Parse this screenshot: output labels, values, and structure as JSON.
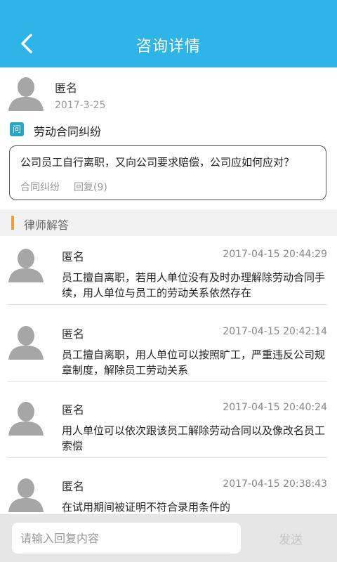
{
  "header": {
    "title": "咨询详情",
    "back_icon": "chevron-left-icon"
  },
  "question": {
    "asker_name": "匿名",
    "date": "2017-3-25",
    "badge": "问",
    "title": "劳动合同纠纷",
    "content": "公司员工自行离职，又向公司要求赔偿，公司应如何应对？",
    "tag": "合同纠纷",
    "reply_count": "回复(9)"
  },
  "section": {
    "title": "律师解答",
    "accent_color": "#f39c34"
  },
  "answers": [
    {
      "name": "匿名",
      "time": "2017-04-15 20:44:29",
      "text": "员工擅自离职，若用人单位没有及时办理解除劳动合同手续，用人单位与员工的劳动关系依然存在"
    },
    {
      "name": "匿名",
      "time": "2017-04-15 20:42:14",
      "text": "员工擅自离职，用人单位可以按照旷工，严重违反公司规章制度，解除员工劳动关系"
    },
    {
      "name": "匿名",
      "time": "2017-04-15 20:40:24",
      "text": "用人单位可以依次跟该员工解除劳动合同以及像改名员工索偿"
    },
    {
      "name": "匿名",
      "time": "2017-04-15 20:38:43",
      "text": "在试用期间被证明不符合录用条件的"
    }
  ],
  "composer": {
    "placeholder": "请输入回复内容",
    "send_label": "发送"
  },
  "colors": {
    "header": "#2fb4e8",
    "badge": "#2aa5c8"
  }
}
